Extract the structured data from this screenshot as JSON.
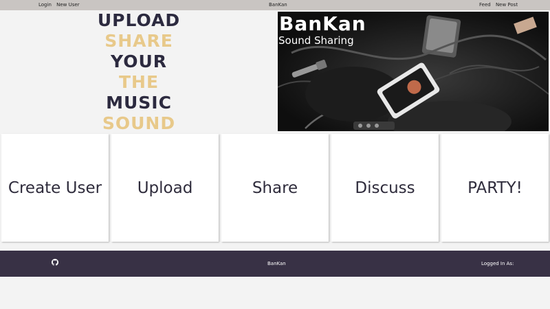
{
  "nav": {
    "login": "Login",
    "new_user": "New User",
    "brand": "BanKan",
    "feed": "Feed",
    "new_post": "New Post"
  },
  "hero": {
    "words": [
      {
        "text": "UPLOAD",
        "color": "dark"
      },
      {
        "text": "SHARE",
        "color": "gold"
      },
      {
        "text": "YOUR",
        "color": "dark"
      },
      {
        "text": "THE",
        "color": "gold"
      },
      {
        "text": "MUSIC",
        "color": "dark"
      },
      {
        "text": "SOUND",
        "color": "gold"
      }
    ],
    "image_title": "BanKan",
    "image_subtitle": "Sound Sharing"
  },
  "cards": [
    {
      "label": "Create User"
    },
    {
      "label": "Upload"
    },
    {
      "label": "Share"
    },
    {
      "label": "Discuss"
    },
    {
      "label": "PARTY!"
    }
  ],
  "footer": {
    "github_icon": "github-icon",
    "brand": "BanKan",
    "logged_in": "Logged In As:"
  },
  "colors": {
    "topbar": "#c9c5c2",
    "footer": "#383145",
    "dark_text": "#2c2a3f",
    "gold_text": "#e8c98a"
  }
}
